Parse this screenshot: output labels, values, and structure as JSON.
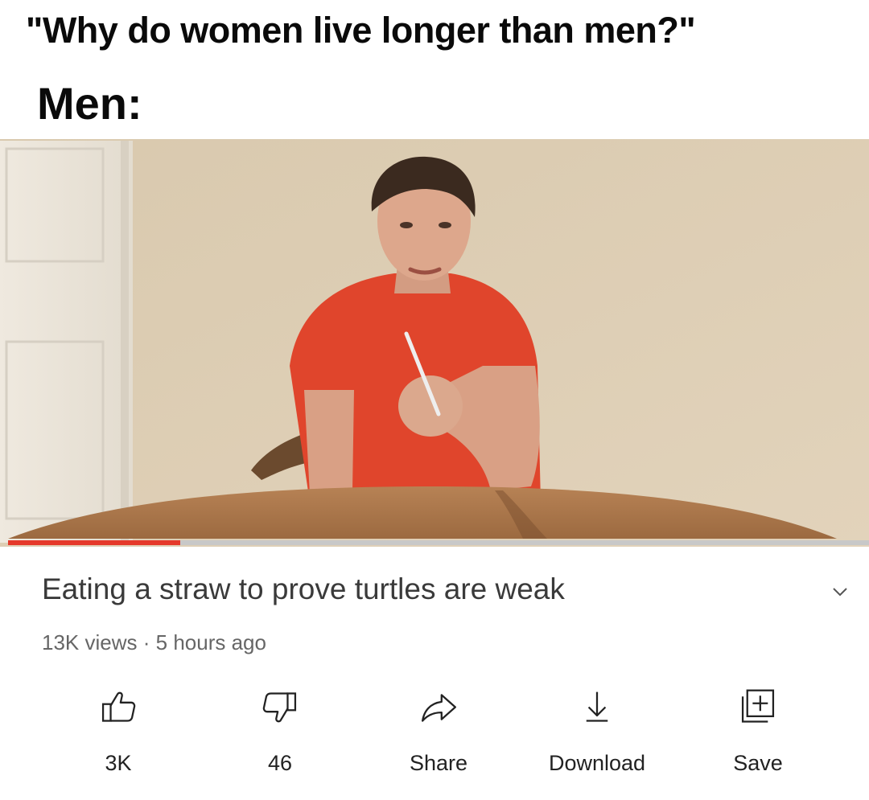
{
  "meme": {
    "question": "\"Why do women live longer than men?\"",
    "answer_label": "Men:"
  },
  "video": {
    "title": "Eating a straw to prove turtles are weak",
    "views": "13K views",
    "separator": "·",
    "age": "5 hours ago",
    "progress_fraction": 0.2,
    "accent_color": "#e5392b"
  },
  "actions": [
    {
      "id": "like",
      "icon": "thumbs-up-icon",
      "label": "3K"
    },
    {
      "id": "dislike",
      "icon": "thumbs-down-icon",
      "label": "46"
    },
    {
      "id": "share",
      "icon": "share-arrow-icon",
      "label": "Share"
    },
    {
      "id": "download",
      "icon": "download-arrow-icon",
      "label": "Download"
    },
    {
      "id": "save",
      "icon": "add-to-playlist-icon",
      "label": "Save"
    }
  ]
}
